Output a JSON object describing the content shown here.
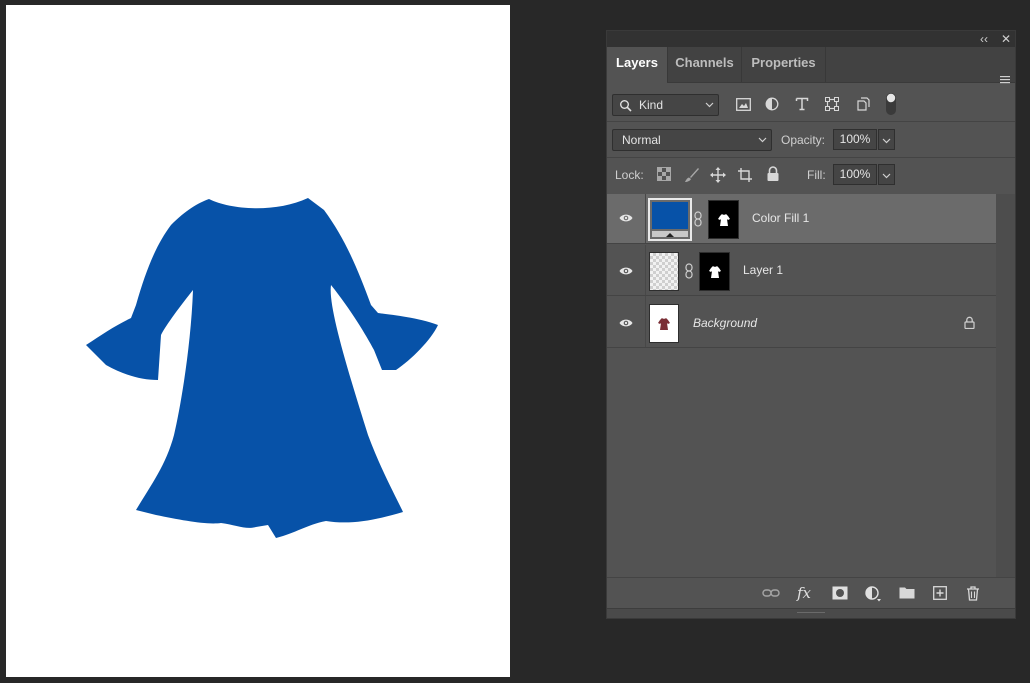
{
  "panel": {
    "collapse_glyph": "‹‹",
    "close_glyph": "✕",
    "tabs": [
      "Layers",
      "Channels",
      "Properties"
    ],
    "active_tab": "Layers"
  },
  "filter": {
    "kind_label": "Kind",
    "filter_icons": [
      "image-filter-icon",
      "adjustment-filter-icon",
      "type-filter-icon",
      "shape-filter-icon",
      "smart-object-filter-icon",
      "filter-toggle-icon"
    ]
  },
  "blend": {
    "mode": "Normal",
    "opacity_label": "Opacity:",
    "opacity_value": "100%"
  },
  "lock": {
    "label": "Lock:",
    "icons": [
      "lock-transparent-icon",
      "lock-paint-icon",
      "lock-position-icon",
      "lock-artboard-icon",
      "lock-all-icon"
    ],
    "fill_label": "Fill:",
    "fill_value": "100%"
  },
  "layers": [
    {
      "name": "Color Fill 1",
      "selected": true,
      "italic": false
    },
    {
      "name": "Layer 1",
      "selected": false,
      "italic": false
    },
    {
      "name": "Background",
      "selected": false,
      "italic": true,
      "locked": true
    }
  ],
  "footer": {
    "icons": [
      "link-layers-icon",
      "fx-icon",
      "add-mask-icon",
      "adjustment-layer-icon",
      "new-group-icon",
      "new-layer-icon",
      "delete-layer-icon"
    ],
    "fx_label": "fx"
  },
  "colors": {
    "dress_fill": "#0752a8",
    "canvas_bg": "#ffffff",
    "app_bg": "#282828",
    "panel_bg": "#535353",
    "selected_layer": "#6b6b6b"
  }
}
